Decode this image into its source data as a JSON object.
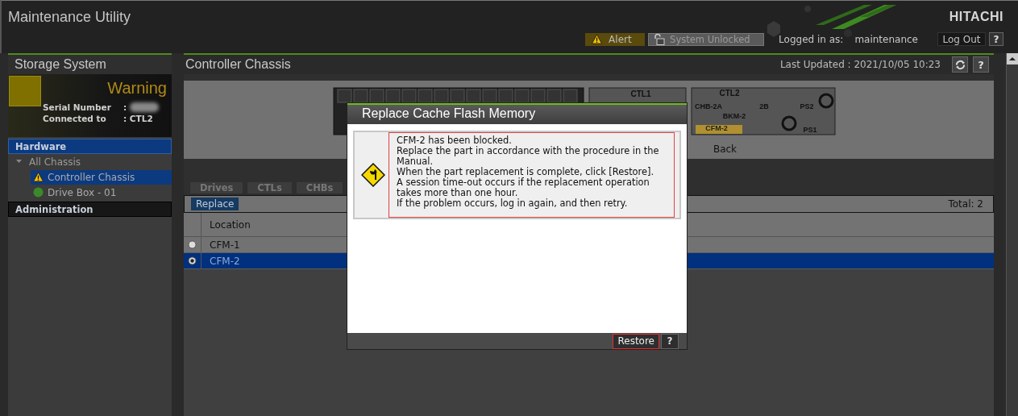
{
  "app": {
    "title": "Maintenance Utility",
    "brand": "HITACHI"
  },
  "top_bar": {
    "alert": "Alert",
    "lock": "System Unlocked",
    "login_label": "Logged in as:",
    "user": "maintenance",
    "logout": "Log Out",
    "help": "?"
  },
  "sidebar": {
    "title": "Storage System",
    "status": "Warning",
    "info": [
      {
        "label": "Serial Number",
        "value": ":",
        "redacted": true
      },
      {
        "label": "Connected to",
        "value": ": CTL2",
        "redacted": false
      }
    ],
    "sections": [
      {
        "title": "Hardware",
        "selected": true,
        "tree": [
          {
            "label": "All Chassis",
            "expanded": true,
            "children": [
              {
                "label": "Controller Chassis",
                "kind": "warning",
                "selected": true
              },
              {
                "label": "Drive Box - 01",
                "kind": "normal",
                "selected": false
              }
            ]
          }
        ]
      },
      {
        "title": "Administration",
        "selected": false
      }
    ]
  },
  "main": {
    "title": "Controller Chassis",
    "last_updated": "Last Updated : 2021/10/05 10:23",
    "help": "?",
    "chassis_labels": [
      {
        "text": "CTL1",
        "kind": "controller"
      },
      {
        "text": "CTL2",
        "kind": "controller"
      },
      {
        "text": "CHB-2A",
        "kind": "part"
      },
      {
        "text": "2B",
        "kind": "part"
      },
      {
        "text": "BKM-2",
        "kind": "part"
      },
      {
        "text": "CFM-2",
        "kind": "warning"
      },
      {
        "text": "PS2",
        "kind": "part"
      },
      {
        "text": "PS1",
        "kind": "part"
      }
    ],
    "back": "Back",
    "tabs": [
      {
        "label": "Drives",
        "selected": false
      },
      {
        "label": "CTLs",
        "selected": false
      },
      {
        "label": "CHBs",
        "selected": false
      }
    ],
    "toolbar": {
      "replace": "Replace",
      "total": "Total: 2"
    },
    "table": {
      "columns": [
        "Location"
      ],
      "rows": [
        {
          "location": "CFM-1",
          "selected": false
        },
        {
          "location": "CFM-2",
          "selected": true
        }
      ]
    }
  },
  "dialog": {
    "title": "Replace Cache Flash Memory",
    "message": [
      "CFM-2 has been blocked.",
      "Replace the part in accordance with the procedure in the Manual.",
      "When the part replacement is complete, click [Restore].",
      "A session time-out occurs if the replacement operation takes more than one hour.",
      "If the problem occurs, log in again, and then retry."
    ],
    "buttons": [
      {
        "label": "Restore",
        "kind": "primary"
      },
      {
        "label": "?",
        "kind": "help"
      }
    ]
  }
}
